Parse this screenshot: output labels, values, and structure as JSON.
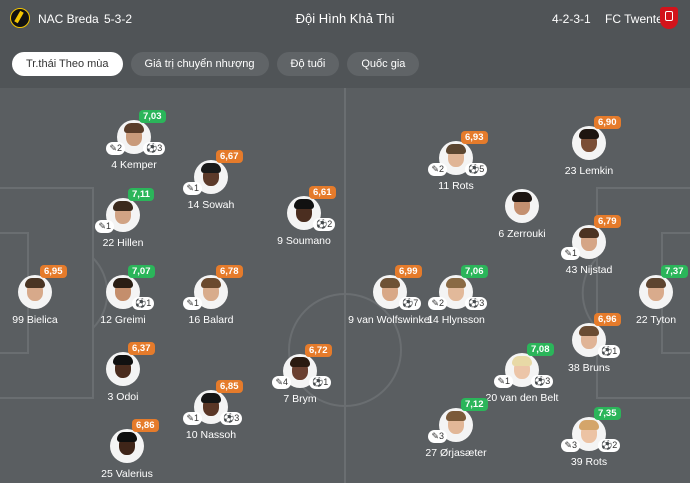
{
  "header": {
    "home_team": "NAC Breda",
    "home_formation": "5-3-2",
    "title": "Đội Hình Khả Thi",
    "away_formation": "4-2-3-1",
    "away_team": "FC Twente"
  },
  "tabs": [
    "Tr.thái Theo mùa",
    "Giá trị chuyển nhượng",
    "Độ tuổi",
    "Quốc gia"
  ],
  "colors": {
    "rating_orange": "#e57b2b",
    "rating_green": "#2bb55a",
    "pitch": "#5a5e61"
  },
  "icons": {
    "assist": "boot-icon",
    "goal": "ball-icon"
  },
  "players": [
    {
      "name": "4 Kemper",
      "rating": "7,03",
      "rc": "green",
      "a": "2",
      "g": "3"
    },
    {
      "name": "14 Sowah",
      "rating": "6,67",
      "rc": "orange",
      "a": "1",
      "g": ""
    },
    {
      "name": "22 Hillen",
      "rating": "7,11",
      "rc": "green",
      "a": "1",
      "g": ""
    },
    {
      "name": "9 Soumano",
      "rating": "6,61",
      "rc": "orange",
      "a": "",
      "g": "2"
    },
    {
      "name": "99 Bielica",
      "rating": "6,95",
      "rc": "orange",
      "a": "",
      "g": ""
    },
    {
      "name": "12 Greimi",
      "rating": "7,07",
      "rc": "green",
      "a": "",
      "g": "1"
    },
    {
      "name": "16 Balard",
      "rating": "6,78",
      "rc": "orange",
      "a": "1",
      "g": ""
    },
    {
      "name": "3 Odoi",
      "rating": "6,37",
      "rc": "orange",
      "a": "",
      "g": ""
    },
    {
      "name": "7 Brym",
      "rating": "6,72",
      "rc": "orange",
      "a": "4",
      "g": "1"
    },
    {
      "name": "10 Nassoh",
      "rating": "6,85",
      "rc": "orange",
      "a": "1",
      "g": "3"
    },
    {
      "name": "25 Valerius",
      "rating": "6,86",
      "rc": "orange",
      "a": "",
      "g": ""
    },
    {
      "name": "11 Rots",
      "rating": "6,93",
      "rc": "orange",
      "a": "2",
      "g": "5"
    },
    {
      "name": "23 Lemkin",
      "rating": "6,90",
      "rc": "orange",
      "a": "",
      "g": ""
    },
    {
      "name": "6 Zerrouki",
      "rating": "",
      "rc": "orange",
      "a": "",
      "g": ""
    },
    {
      "name": "43 Nijstad",
      "rating": "6,79",
      "rc": "orange",
      "a": "1",
      "g": ""
    },
    {
      "name": "9 van Wolfswinkel",
      "rating": "6,99",
      "rc": "orange",
      "a": "",
      "g": "7"
    },
    {
      "name": "14 Hlynsson",
      "rating": "7,06",
      "rc": "green",
      "a": "2",
      "g": "3"
    },
    {
      "name": "22 Tyton",
      "rating": "7,37",
      "rc": "green",
      "a": "",
      "g": ""
    },
    {
      "name": "38 Bruns",
      "rating": "6,96",
      "rc": "orange",
      "a": "",
      "g": "1"
    },
    {
      "name": "20 van den Belt",
      "rating": "7,08",
      "rc": "green",
      "a": "1",
      "g": "3"
    },
    {
      "name": "27 Ørjasæter",
      "rating": "7,12",
      "rc": "green",
      "a": "3",
      "g": ""
    },
    {
      "name": "39 Rots",
      "rating": "7,35",
      "rc": "green",
      "a": "3",
      "g": "2"
    }
  ]
}
